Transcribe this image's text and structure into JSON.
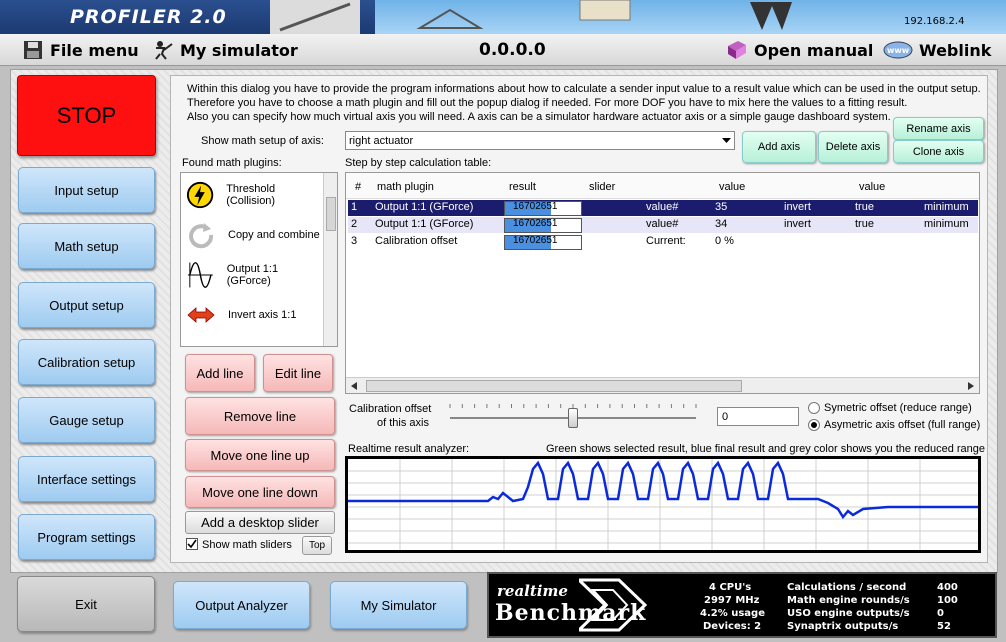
{
  "app": {
    "banner_title": "PROFILER 2.0",
    "ip_address": "192.168.2.4"
  },
  "menu": {
    "file": "File menu",
    "simulator": "My simulator",
    "version": "0.0.0.0",
    "manual": "Open manual",
    "weblink": "Weblink"
  },
  "nav": {
    "stop": "STOP",
    "items": [
      "Input setup",
      "Math setup",
      "Output setup",
      "Calibration setup",
      "Gauge setup",
      "Interface settings",
      "Program settings"
    ],
    "exit": "Exit",
    "output_analyzer": "Output Analyzer",
    "my_simulator": "My Simulator"
  },
  "math": {
    "description": [
      "Within this dialog you have to provide the program informations about how to calculate a sender input value to a result value which can be used in the output setup.",
      "Therefore you have to choose a math plugin and fill out the popup dialog if needed. For more DOF you have to mix here the values to a fitting result.",
      "Also you can specify how much virtual axis you will need. A axis can be a simulator hardware actuator axis or a simple gauge dashboard system."
    ],
    "axis_label": "Show math setup of axis:",
    "axis_value": "right actuator",
    "add_axis": "Add axis",
    "delete_axis": "Delete axis",
    "rename_axis": "Rename axis",
    "clone_axis": "Clone axis",
    "found_plugins_label": "Found math plugins:",
    "plugins": [
      "Threshold (Collision)",
      "Copy and combine",
      "Output 1:1 (GForce)",
      "Invert axis 1:1"
    ],
    "table_label": "Step by step calculation table:",
    "columns": [
      "#",
      "math plugin",
      "result",
      "slider",
      "value",
      "value"
    ],
    "rows": [
      {
        "num": "1",
        "plugin": "Output 1:1 (GForce)",
        "result": "16702651",
        "fill": 0.6,
        "c1": "value#",
        "c2": "35",
        "c3": "invert",
        "c4": "true",
        "c5": "minimum"
      },
      {
        "num": "2",
        "plugin": "Output 1:1 (GForce)",
        "result": "16702651",
        "fill": 0.6,
        "c1": "value#",
        "c2": "34",
        "c3": "invert",
        "c4": "true",
        "c5": "minimum"
      },
      {
        "num": "3",
        "plugin": "Calibration offset",
        "result": "16702651",
        "fill": 0.6,
        "c1": "Current:",
        "c2": "0 %",
        "c3": "",
        "c4": "",
        "c5": ""
      }
    ],
    "buttons": {
      "add_line": "Add line",
      "edit_line": "Edit line",
      "remove_line": "Remove line",
      "move_up": "Move one line up",
      "move_down": "Move one line down",
      "desktop_slider": "Add a desktop slider",
      "show_sliders": "Show math sliders",
      "top": "Top"
    },
    "calibration": {
      "label1": "Calibration offset",
      "label2": "of this axis",
      "value": "0",
      "slider_fraction": 0.5,
      "option1": "Symetric offset (reduce range)",
      "option2": "Asymetric axis offset (full range)"
    },
    "analyzer": {
      "label": "Realtime result analyzer:",
      "legend": "Green shows selected result, blue final result and grey color shows you the reduced range"
    }
  },
  "benchmark": {
    "logo_top": "realtime",
    "logo_bottom": "Benchmark",
    "stats": [
      {
        "value": "4 CPU's",
        "label": "Calculations / second",
        "num": "400"
      },
      {
        "value": "2997 MHz",
        "label": "Math engine rounds/s",
        "num": "100"
      },
      {
        "value": "4.2% usage",
        "label": "USO engine outputs/s",
        "num": "0"
      },
      {
        "value": "Devices: 2",
        "label": "Synaptrix outputs/s",
        "num": "52"
      }
    ]
  }
}
